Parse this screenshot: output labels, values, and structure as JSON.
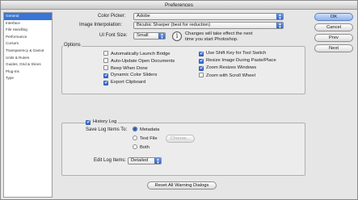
{
  "window": {
    "title": "Preferences"
  },
  "sidebar": {
    "items": [
      {
        "label": "General",
        "selected": true
      },
      {
        "label": "Interface"
      },
      {
        "label": "File Handling"
      },
      {
        "label": "Performance"
      },
      {
        "label": "Cursors"
      },
      {
        "label": "Transparency & Gamut"
      },
      {
        "label": "Units & Rulers"
      },
      {
        "label": "Guides, Grid & Slices"
      },
      {
        "label": "Plug-Ins"
      },
      {
        "label": "Type"
      }
    ]
  },
  "general": {
    "color_picker": {
      "label": "Color Picker:",
      "value": "Adobe"
    },
    "image_interpolation": {
      "label": "Image Interpolation:",
      "value": "Bicubic Sharper (best for reduction)"
    },
    "ui_font_size": {
      "label": "UI Font Size:",
      "value": "Small"
    },
    "font_note_line1": "Changes will take effect the next",
    "font_note_line2": "time you start Photoshop."
  },
  "options": {
    "title": "Options",
    "left": [
      {
        "label": "Automatically Launch Bridge",
        "checked": false
      },
      {
        "label": "Auto-Update Open Documents",
        "checked": false
      },
      {
        "label": "Beep When Done",
        "checked": false
      },
      {
        "label": "Dynamic Color Sliders",
        "checked": true
      },
      {
        "label": "Export Clipboard",
        "checked": true
      }
    ],
    "right": [
      {
        "label": "Use Shift Key for Tool Switch",
        "checked": true
      },
      {
        "label": "Resize Image During Paste/Place",
        "checked": true
      },
      {
        "label": "Zoom Resizes Windows",
        "checked": true
      },
      {
        "label": "Zoom with Scroll Wheel",
        "checked": false
      }
    ]
  },
  "history": {
    "title": "History Log",
    "checked": true,
    "save_label": "Save Log Items To:",
    "radios": [
      {
        "label": "Metadata",
        "selected": true
      },
      {
        "label": "Text File",
        "selected": false
      },
      {
        "label": "Both",
        "selected": false
      }
    ],
    "choose_label": "Choose...",
    "edit_label": "Edit Log Items:",
    "edit_value": "Detailed"
  },
  "reset_label": "Reset All Warning Dialogs",
  "buttons": {
    "ok": "OK",
    "cancel": "Cancel",
    "prev": "Prev",
    "next": "Next"
  }
}
